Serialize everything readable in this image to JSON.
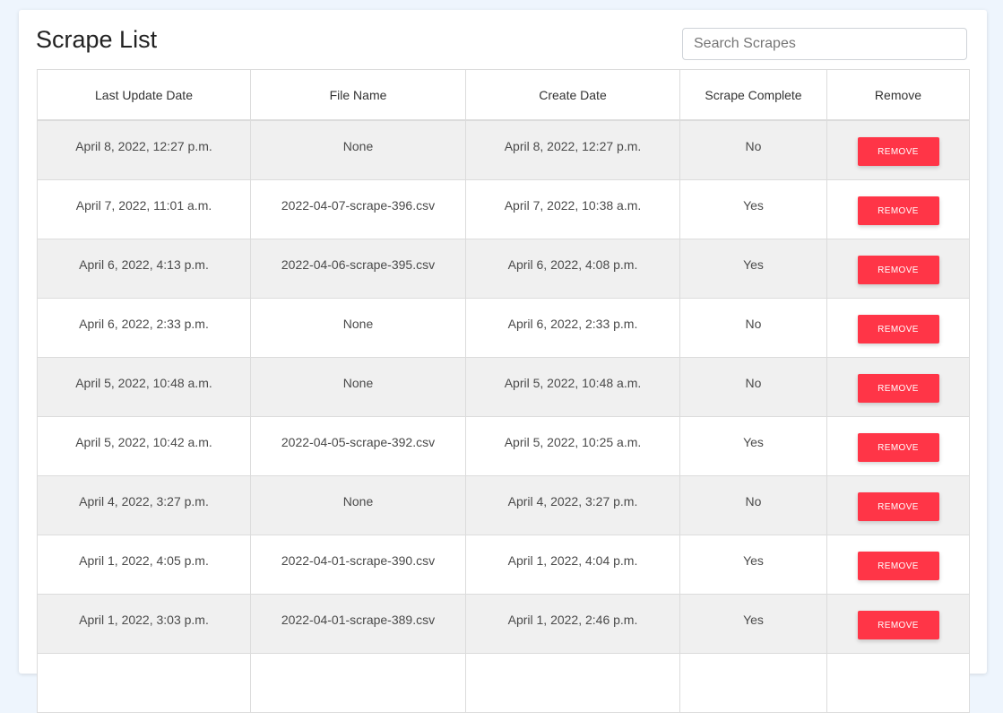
{
  "page": {
    "title": "Scrape List",
    "search_placeholder": "Search Scrapes"
  },
  "table": {
    "headers": [
      "Last Update Date",
      "File Name",
      "Create Date",
      "Scrape Complete",
      "Remove"
    ],
    "remove_label": "REMOVE",
    "rows": [
      {
        "last_update": "April 8, 2022, 12:27 p.m.",
        "file_name": "None",
        "create_date": "April 8, 2022, 12:27 p.m.",
        "complete": "No"
      },
      {
        "last_update": "April 7, 2022, 11:01 a.m.",
        "file_name": "2022-04-07-scrape-396.csv",
        "create_date": "April 7, 2022, 10:38 a.m.",
        "complete": "Yes"
      },
      {
        "last_update": "April 6, 2022, 4:13 p.m.",
        "file_name": "2022-04-06-scrape-395.csv",
        "create_date": "April 6, 2022, 4:08 p.m.",
        "complete": "Yes"
      },
      {
        "last_update": "April 6, 2022, 2:33 p.m.",
        "file_name": "None",
        "create_date": "April 6, 2022, 2:33 p.m.",
        "complete": "No"
      },
      {
        "last_update": "April 5, 2022, 10:48 a.m.",
        "file_name": "None",
        "create_date": "April 5, 2022, 10:48 a.m.",
        "complete": "No"
      },
      {
        "last_update": "April 5, 2022, 10:42 a.m.",
        "file_name": "2022-04-05-scrape-392.csv",
        "create_date": "April 5, 2022, 10:25 a.m.",
        "complete": "Yes"
      },
      {
        "last_update": "April 4, 2022, 3:27 p.m.",
        "file_name": "None",
        "create_date": "April 4, 2022, 3:27 p.m.",
        "complete": "No"
      },
      {
        "last_update": "April 1, 2022, 4:05 p.m.",
        "file_name": "2022-04-01-scrape-390.csv",
        "create_date": "April 1, 2022, 4:04 p.m.",
        "complete": "Yes"
      },
      {
        "last_update": "April 1, 2022, 3:03 p.m.",
        "file_name": "2022-04-01-scrape-389.csv",
        "create_date": "April 1, 2022, 2:46 p.m.",
        "complete": "Yes"
      }
    ]
  },
  "colors": {
    "page_background": "#eef5fd",
    "remove_button": "#ff3547",
    "striped_row": "#f0f0f0"
  }
}
